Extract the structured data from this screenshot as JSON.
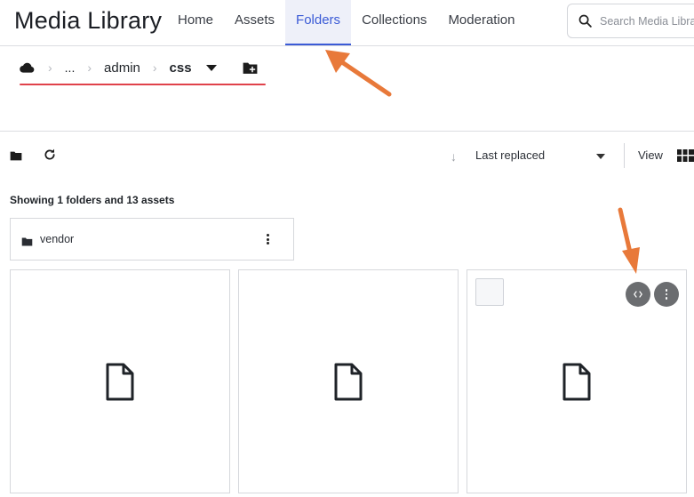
{
  "header": {
    "title": "Media Library",
    "nav": [
      {
        "label": "Home",
        "active": false
      },
      {
        "label": "Assets",
        "active": false
      },
      {
        "label": "Folders",
        "active": true
      },
      {
        "label": "Collections",
        "active": false
      },
      {
        "label": "Moderation",
        "active": false
      }
    ],
    "search_placeholder": "Search Media Library"
  },
  "breadcrumb": {
    "ellipsis": "...",
    "parent": "admin",
    "current": "css",
    "root_icon": "cloud-icon",
    "add_icon": "new-folder-icon"
  },
  "toolbar": {
    "sort_label": "Last replaced",
    "sort_direction_icon": "arrow-down-icon",
    "view_label": "View",
    "view_icon": "grid-view-icon",
    "folder_icon": "folder-icon",
    "refresh_icon": "refresh-icon"
  },
  "summary": "Showing 1 folders and 13 assets",
  "folders": [
    {
      "name": "vendor"
    }
  ],
  "assets": [
    {
      "icon": "file-icon",
      "hovered": false
    },
    {
      "icon": "file-icon",
      "hovered": false
    },
    {
      "icon": "file-icon",
      "hovered": true,
      "actions": [
        "code-icon",
        "more-vertical-icon"
      ]
    }
  ],
  "colors": {
    "accent": "#3b5bd6",
    "annotation_arrow": "#e8793a",
    "annotation_underline": "#e0424a"
  }
}
